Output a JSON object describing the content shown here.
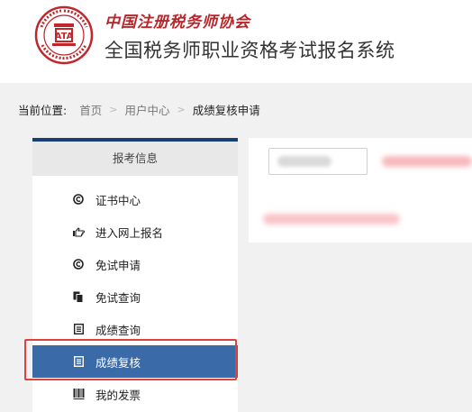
{
  "header": {
    "org_name": "中国注册税务师协会",
    "system_name": "全国税务师职业资格考试报名系统"
  },
  "breadcrumb": {
    "prefix": "当前位置:",
    "items": [
      "首页",
      "用户中心"
    ],
    "separator": ">",
    "current": "成绩复核申请"
  },
  "sidebar": {
    "title": "报考信息",
    "accent_color": "#1a3f73",
    "active_color": "#3a6aa8",
    "items": [
      {
        "label": "证书中心",
        "icon": "copyright-circle-icon"
      },
      {
        "label": "进入网上报名",
        "icon": "hand-pointer-icon"
      },
      {
        "label": "免试申请",
        "icon": "copyright-circle-icon"
      },
      {
        "label": "免试查询",
        "icon": "documents-icon"
      },
      {
        "label": "成绩查询",
        "icon": "list-document-icon"
      },
      {
        "label": "成绩复核",
        "icon": "list-document-icon",
        "active": true
      },
      {
        "label": "我的发票",
        "icon": "barcode-icon"
      }
    ]
  },
  "annotation": {
    "highlight_color": "#e0413a"
  }
}
